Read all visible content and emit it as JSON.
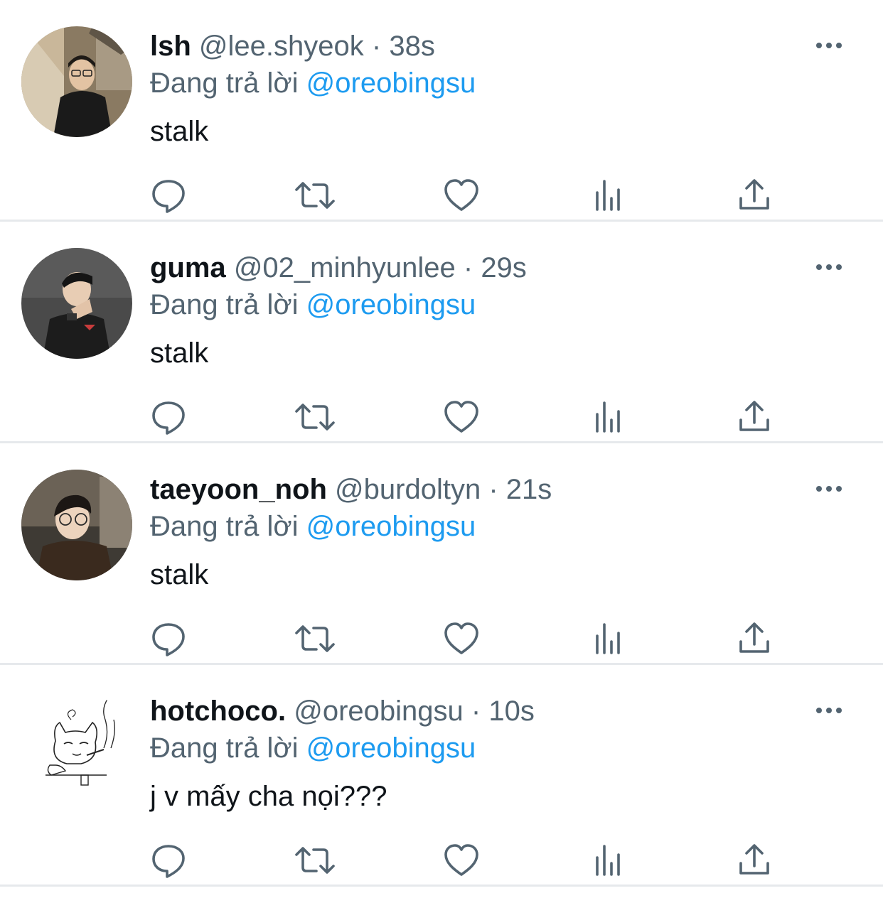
{
  "colors": {
    "text": "#0f1419",
    "secondary": "#536471",
    "link": "#1d9bf0",
    "divider": "#e6e9ec"
  },
  "icons": {
    "reply": "speech-bubble-icon",
    "retweet": "retweet-arrows-icon",
    "like": "heart-icon",
    "views": "bar-chart-icon",
    "share": "share-upload-icon",
    "more": "ellipsis-icon"
  },
  "tweets": [
    {
      "display_name": "lsh",
      "handle": "@lee.shyeok",
      "separator": "·",
      "time": "38s",
      "reply_prefix": "Đang trả lời",
      "reply_to": "@oreobingsu",
      "text": "stalk"
    },
    {
      "display_name": "guma",
      "handle": "@02_minhyunlee",
      "separator": "·",
      "time": "29s",
      "reply_prefix": "Đang trả lời",
      "reply_to": "@oreobingsu",
      "text": "stalk"
    },
    {
      "display_name": "taeyoon_noh",
      "handle": "@burdoltyn",
      "separator": "·",
      "time": "21s",
      "reply_prefix": "Đang trả lời",
      "reply_to": "@oreobingsu",
      "text": "stalk"
    },
    {
      "display_name": "hotchoco.",
      "handle": "@oreobingsu",
      "separator": "·",
      "time": "10s",
      "reply_prefix": "Đang trả lời",
      "reply_to": "@oreobingsu",
      "text": "j v mấy cha nọi???"
    }
  ]
}
